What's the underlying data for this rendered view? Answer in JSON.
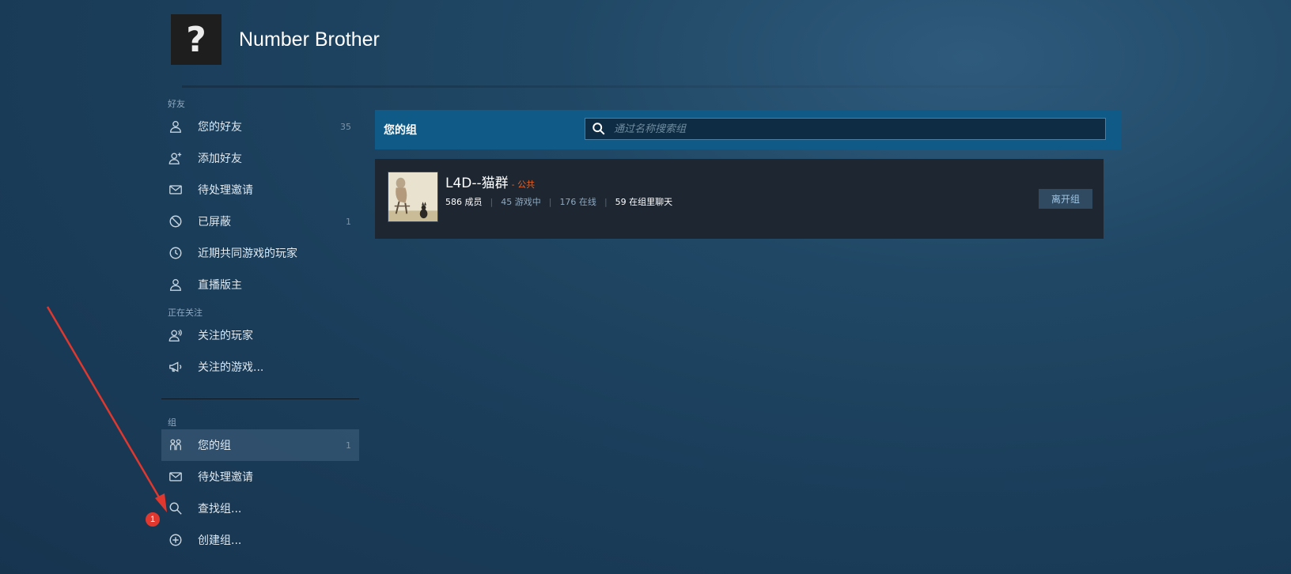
{
  "profile": {
    "avatar_glyph": "?",
    "name": "Number Brother"
  },
  "sidebar": {
    "friends_section": "好友",
    "friends_items": [
      {
        "label": "您的好友",
        "count": "35",
        "icon": "person-icon"
      },
      {
        "label": "添加好友",
        "count": "",
        "icon": "add-person-icon"
      },
      {
        "label": "待处理邀请",
        "count": "",
        "icon": "envelope-icon"
      },
      {
        "label": "已屏蔽",
        "count": "1",
        "icon": "blocked-icon"
      },
      {
        "label": "近期共同游戏的玩家",
        "count": "",
        "icon": "clock-icon"
      },
      {
        "label": "直播版主",
        "count": "",
        "icon": "person-icon"
      }
    ],
    "following_section": "正在关注",
    "following_items": [
      {
        "label": "关注的玩家",
        "count": "",
        "icon": "followed-person-icon"
      },
      {
        "label": "关注的游戏...",
        "count": "",
        "icon": "megaphone-icon"
      }
    ],
    "groups_section": "组",
    "groups_items": [
      {
        "label": "您的组",
        "count": "1",
        "icon": "group-icon",
        "active": true
      },
      {
        "label": "待处理邀请",
        "count": "",
        "icon": "envelope-icon"
      },
      {
        "label": "查找组...",
        "count": "",
        "icon": "search-icon"
      },
      {
        "label": "创建组...",
        "count": "",
        "icon": "plus-circle-icon"
      }
    ]
  },
  "main": {
    "title": "您的组",
    "search_placeholder": "通过名称搜索组",
    "groups": [
      {
        "name": "L4D--猫群",
        "visibility": "- 公共",
        "members": "586 成员",
        "in_game": "45 游戏中",
        "online": "176 在线",
        "in_chat": "59 在组里聊天",
        "leave_label": "离开组"
      }
    ]
  },
  "annotation": {
    "badge_number": "1",
    "color": "#e0382e"
  },
  "colors": {
    "header_bar": "#0f5a86",
    "card_bg": "#1d2631",
    "public_tag": "#e0642a",
    "leave_button_bg": "#2f4a61"
  }
}
